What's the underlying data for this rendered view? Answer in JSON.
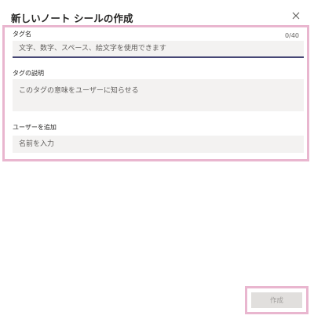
{
  "dialog": {
    "title": "新しいノート シールの作成",
    "close_icon": "close-icon"
  },
  "form": {
    "tag_name": {
      "label": "タグ名",
      "counter": "0/40",
      "placeholder": "文字、数字、スペース、絵文字を使用できます",
      "value": ""
    },
    "tag_description": {
      "label": "タグの説明",
      "placeholder": "このタグの意味をユーザーに知らせる",
      "value": ""
    },
    "add_users": {
      "label": "ユーザーを追加",
      "placeholder": "名前を入力",
      "value": ""
    }
  },
  "footer": {
    "create_label": "作成"
  }
}
